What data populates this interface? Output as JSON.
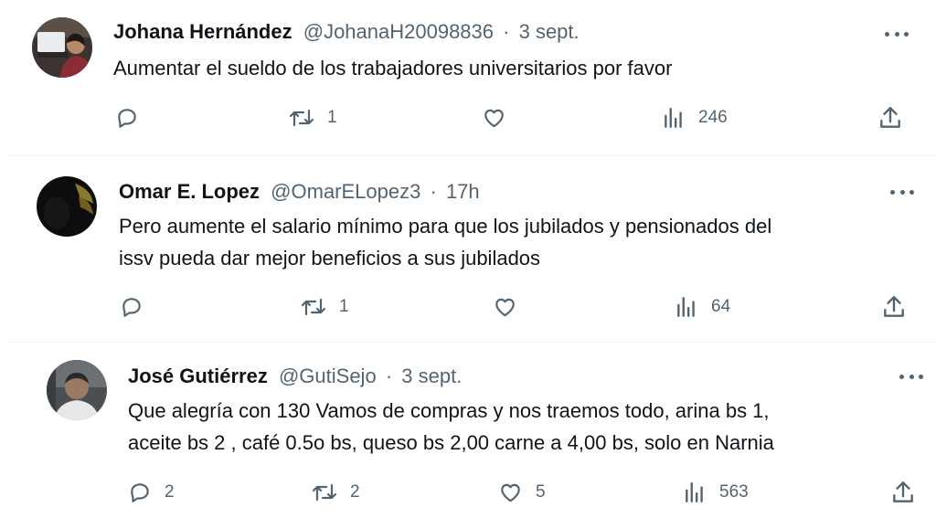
{
  "tweets": [
    {
      "name": "Johana Hernández",
      "handle": "@JohanaH20098836",
      "time": "3 sept.",
      "text_lines": [
        "Aumentar el sueldo de los trabajadores universitarios por favor"
      ],
      "replies": "",
      "retweets": "1",
      "likes": "",
      "views": "246"
    },
    {
      "name": "Omar E. Lopez",
      "handle": "@OmarELopez3",
      "time": "17h",
      "text_lines": [
        "Pero aumente el salario mínimo para que los jubilados y pensionados del",
        "issv pueda dar mejor beneficios a sus jubilados"
      ],
      "replies": "",
      "retweets": "1",
      "likes": "",
      "views": "64"
    },
    {
      "name": "José Gutiérrez",
      "handle": "@GutiSejo",
      "time": "3 sept.",
      "text_lines": [
        "Que alegría con 130 Vamos de compras y nos traemos todo, arina bs 1,",
        "aceite bs 2 , café 0.5o bs, queso bs 2,00 carne a 4,00 bs, solo en Narnia"
      ],
      "replies": "2",
      "retweets": "2",
      "likes": "5",
      "views": "563"
    }
  ],
  "separator_dot": "·",
  "icons": {
    "reply": "reply-icon",
    "retweet": "retweet-icon",
    "like": "like-icon",
    "views": "views-icon",
    "share": "share-icon",
    "more": "more-icon"
  },
  "colors": {
    "text": "#0f1419",
    "secondary": "#536471",
    "divider": "#eff3f4"
  }
}
